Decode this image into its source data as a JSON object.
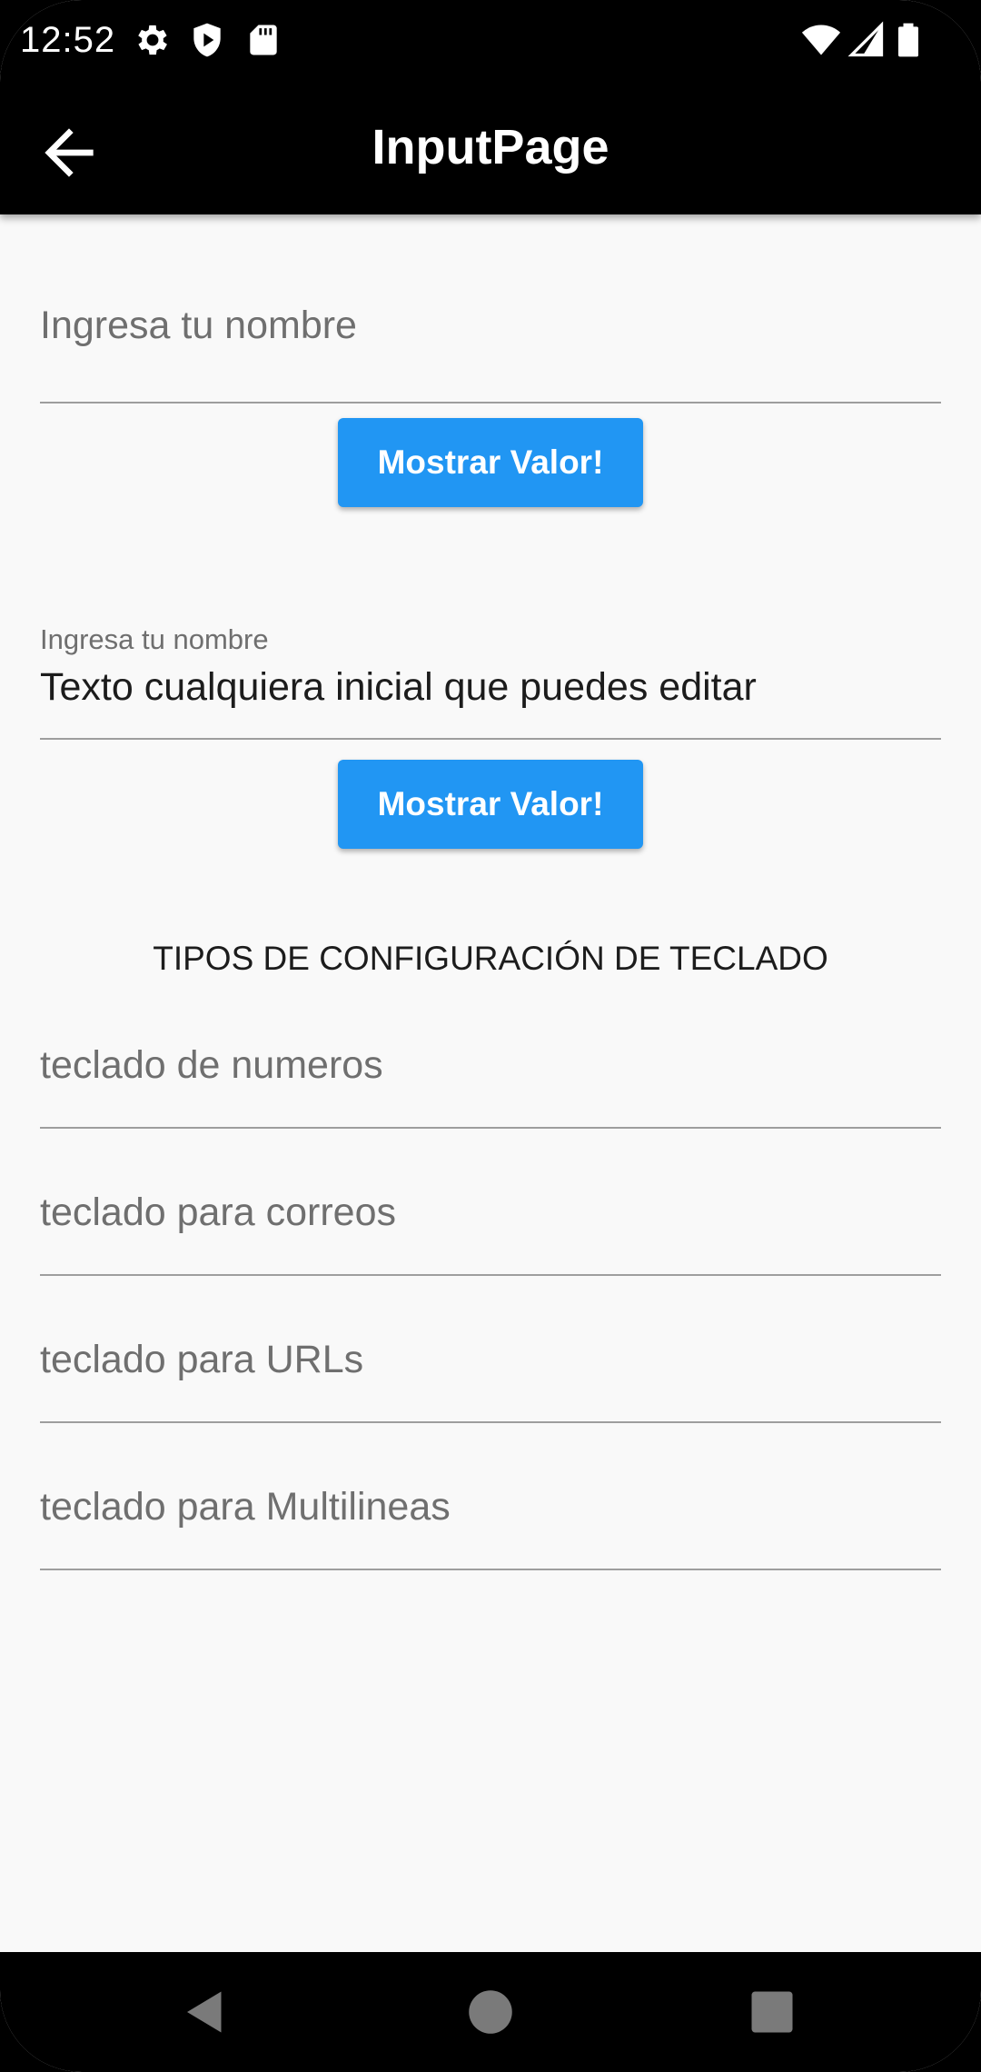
{
  "status_bar": {
    "time": "12:52",
    "left_icons": [
      "gear-icon",
      "shield-play-icon",
      "sd-card-icon"
    ],
    "right_icons": [
      "wifi-icon",
      "cell-signal-icon",
      "battery-icon"
    ]
  },
  "app_bar": {
    "title": "InputPage",
    "back_icon": "arrow-back-icon"
  },
  "form": {
    "name_field_1": {
      "placeholder": "Ingresa tu nombre",
      "value": ""
    },
    "show_value_button_1": "Mostrar Valor!",
    "name_field_2": {
      "label": "Ingresa tu nombre",
      "value": "Texto cualquiera inicial que puedes editar"
    },
    "show_value_button_2": "Mostrar Valor!",
    "keyboard_section_title": "TIPOS DE CONFIGURACIÓN DE TECLADO",
    "keyboard_fields": [
      {
        "placeholder": "teclado de numeros"
      },
      {
        "placeholder": "teclado para correos"
      },
      {
        "placeholder": "teclado para URLs"
      },
      {
        "placeholder": "teclado para Multilineas"
      }
    ]
  },
  "colors": {
    "primary_button": "#2196f3",
    "app_bar": "#000000",
    "background": "#f9f9f9"
  },
  "nav_bar": {
    "buttons": [
      "back-triangle-icon",
      "home-circle-icon",
      "recents-square-icon"
    ]
  }
}
